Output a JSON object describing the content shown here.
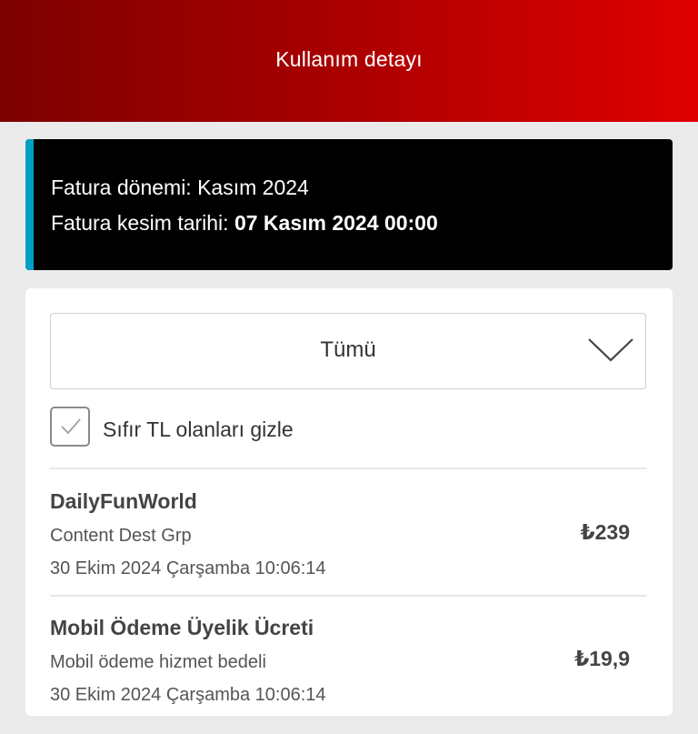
{
  "header": {
    "title": "Kullanım detayı"
  },
  "billing": {
    "period_label": "Fatura dönemi:",
    "period_value": "Kasım 2024",
    "cut_label": "Fatura kesim tarihi:",
    "cut_value": "07 Kasım 2024 00:00",
    "accent_color": "#00a0c6"
  },
  "filter": {
    "selected": "Tümü",
    "hide_zero_label": "Sıfır TL olanları gizle",
    "hide_zero_checked": true
  },
  "transactions": [
    {
      "title": "DailyFunWorld",
      "subtitle": "Content Dest Grp",
      "date": "30 Ekim 2024 Çarşamba 10:06:14",
      "amount": "₺239"
    },
    {
      "title": "Mobil Ödeme Üyelik Ücreti",
      "subtitle": "Mobil ödeme hizmet bedeli",
      "date": "30 Ekim 2024 Çarşamba 10:06:14",
      "amount": "₺19,9"
    }
  ],
  "colors": {
    "brand_red": "#e60000",
    "brand_dark_red": "#7d0000"
  }
}
